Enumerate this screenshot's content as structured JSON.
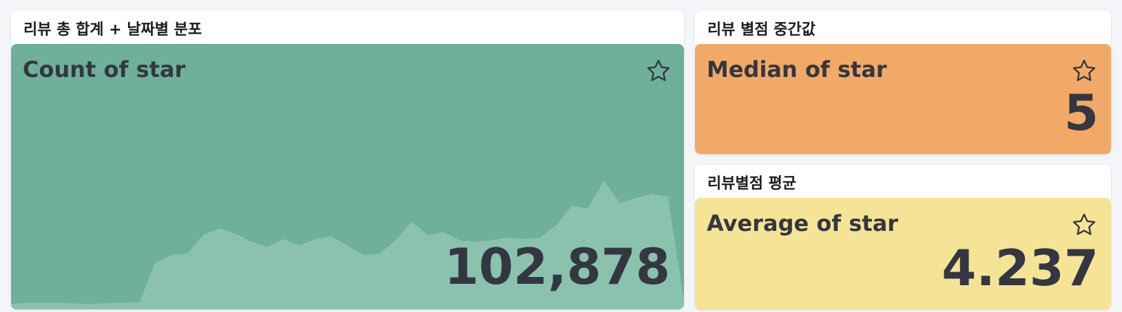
{
  "panels": {
    "count": {
      "title": "리뷰 총 합계 + 날짜별 분포",
      "label": "Count of star",
      "value": "102,878",
      "color": "#6eb09a",
      "trend_color": "#8ac2ad",
      "star_icon": "star-outline-icon",
      "trend": [
        2,
        2.4,
        2.5,
        2.4,
        2.2,
        2,
        2.3,
        2.5,
        2.6,
        17.5,
        20.5,
        21,
        28,
        30.5,
        28.5,
        25.5,
        23.5,
        26.5,
        24,
        26.5,
        27.5,
        24,
        20.5,
        21,
        26,
        33,
        28,
        29,
        26,
        25.5,
        26,
        27,
        26.5,
        27,
        31.5,
        39,
        38,
        48.5,
        40,
        42,
        43.5,
        42.5,
        3
      ]
    },
    "median": {
      "title": "리뷰 별점 중간값",
      "label": "Median of star",
      "value": "5",
      "color": "#f2a967",
      "star_icon": "star-outline-icon"
    },
    "average": {
      "title": "리뷰별점 평균",
      "label": "Average of star",
      "value": "4.237",
      "color": "#f5e495",
      "star_icon": "star-outline-icon"
    }
  }
}
